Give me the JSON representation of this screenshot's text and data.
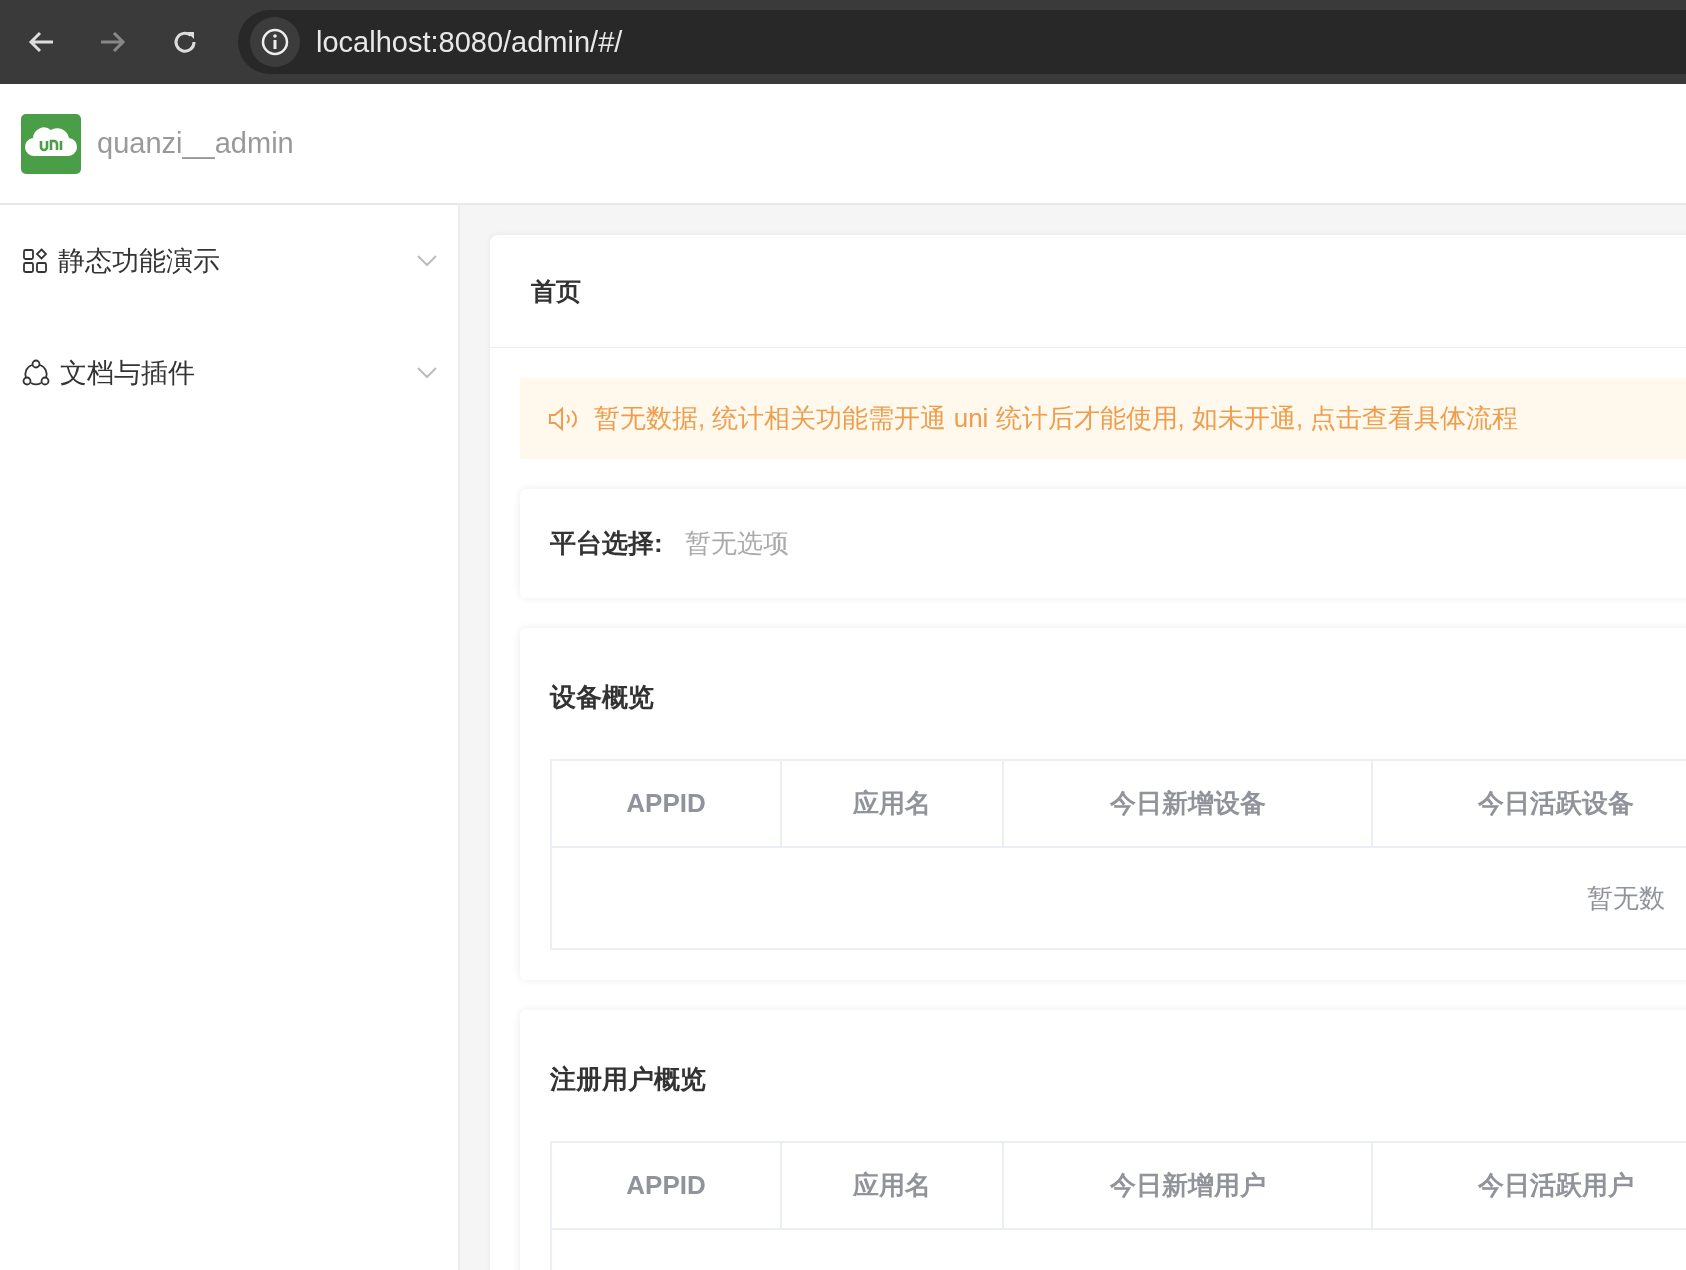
{
  "browser": {
    "url": "localhost:8080/admin/#/"
  },
  "header": {
    "app_name": "quanzi__admin"
  },
  "sidebar": {
    "items": [
      {
        "kind": "grid",
        "label": "静态功能演示",
        "expanded": false
      },
      {
        "kind": "share",
        "label": "文档与插件",
        "expanded": false
      }
    ]
  },
  "page_title": "首页",
  "notice": {
    "text": "暂无数据, 统计相关功能需开通 uni 统计后才能使用, 如未开通, 点击查看具体流程"
  },
  "platform_filter": {
    "label": "平台选择:",
    "placeholder": "暂无选项"
  },
  "sections": [
    {
      "title": "设备概览",
      "table": {
        "columns": [
          "APPID",
          "应用名",
          "今日新增设备",
          "今日活跃设备"
        ],
        "empty_text": "暂无数"
      }
    },
    {
      "title": "注册用户概览",
      "table": {
        "columns": [
          "APPID",
          "应用名",
          "今日新增用户",
          "今日活跃用户"
        ]
      }
    }
  ]
}
